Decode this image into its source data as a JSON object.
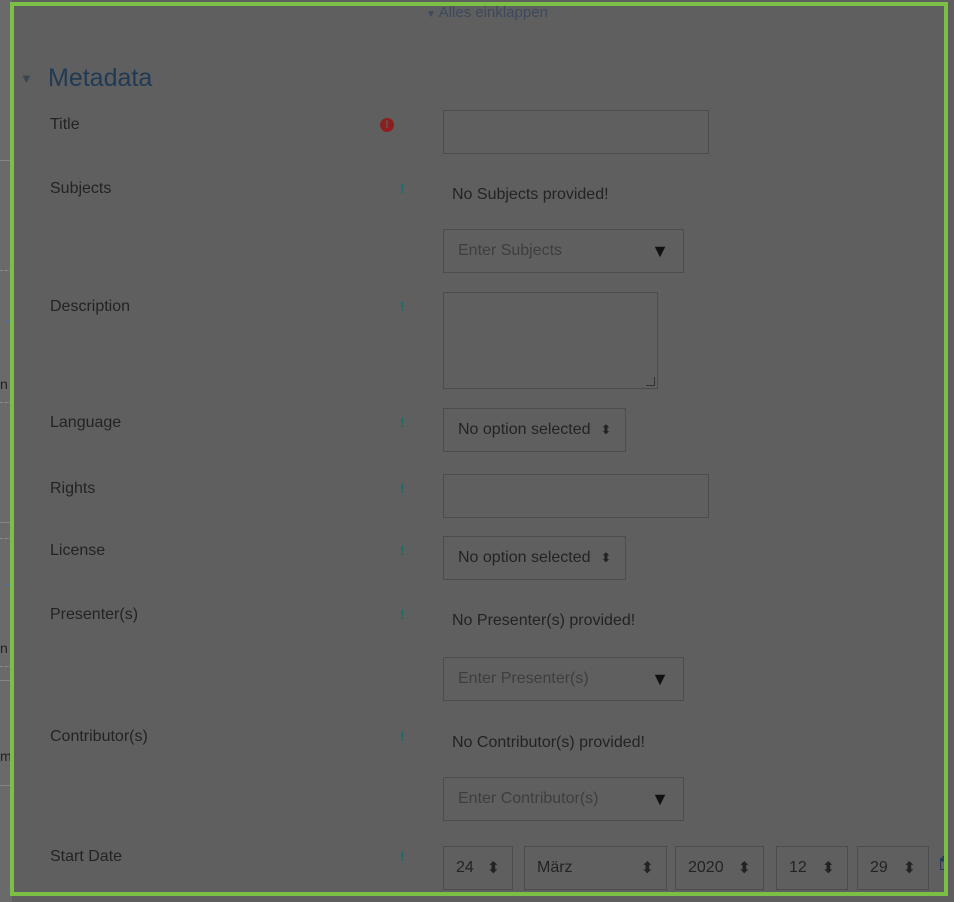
{
  "header": {
    "collapse_all": "Alles einklappen"
  },
  "section": {
    "title": "Metadata"
  },
  "icons": {
    "required": "exclamation-circle-icon",
    "help": "help-exclamation-icon",
    "calendar": "calendar-icon"
  },
  "fields": {
    "title": {
      "label": "Title"
    },
    "subjects": {
      "label": "Subjects",
      "empty_text": "No Subjects provided!",
      "placeholder": "Enter Subjects"
    },
    "description": {
      "label": "Description"
    },
    "language": {
      "label": "Language",
      "value": "No option selected"
    },
    "rights": {
      "label": "Rights"
    },
    "license": {
      "label": "License",
      "value": "No option selected"
    },
    "presenters": {
      "label": "Presenter(s)",
      "empty_text": "No Presenter(s) provided!",
      "placeholder": "Enter Presenter(s)"
    },
    "contributors": {
      "label": "Contributor(s)",
      "empty_text": "No Contributor(s) provided!",
      "placeholder": "Enter Contributor(s)"
    },
    "start_date": {
      "label": "Start Date",
      "day": "24",
      "month": "März",
      "year": "2020",
      "hour": "12",
      "minute": "29"
    }
  },
  "glyphs": {
    "select_arrow": "⬍",
    "combo_arrow": "▼",
    "help": "!",
    "required": "!"
  },
  "left_fragments": [
    "n",
    "n",
    "m"
  ]
}
